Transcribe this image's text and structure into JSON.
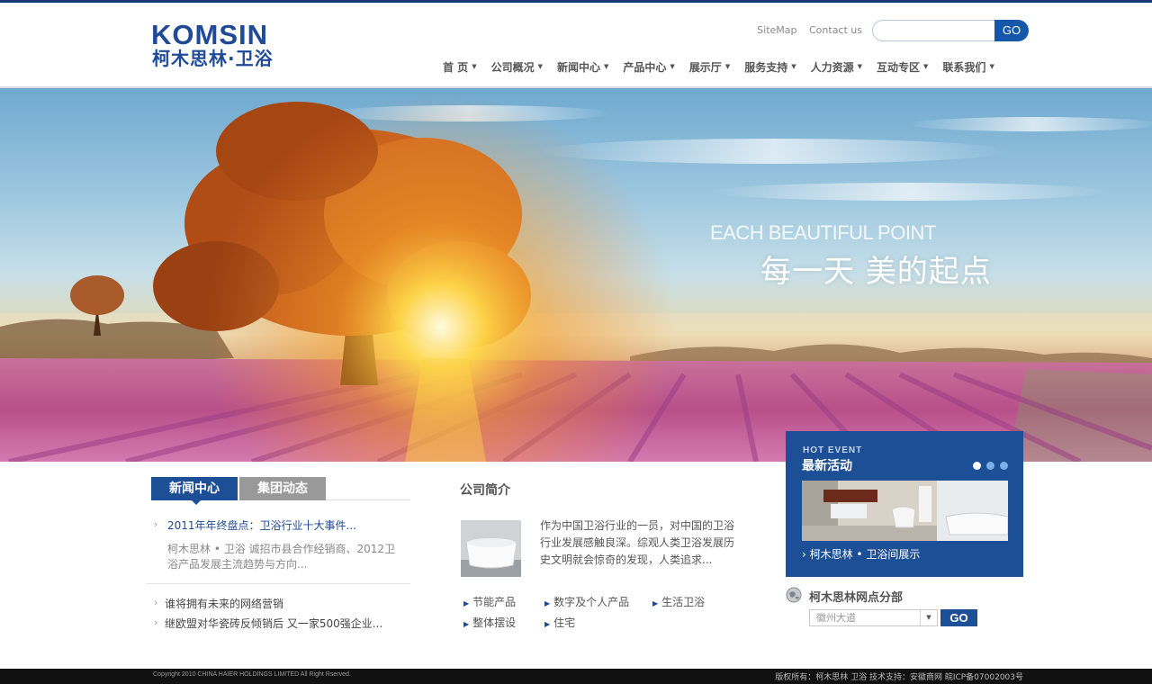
{
  "header": {
    "logo_en": "KOMSIN",
    "logo_cn": "柯木思林·卫浴",
    "top_links": [
      "SiteMap",
      "Contact us"
    ],
    "search": {
      "placeholder": "",
      "button": "GO"
    },
    "nav": [
      "首 页",
      "公司概况",
      "新闻中心",
      "产品中心",
      "展示厅",
      "服务支持",
      "人力资源",
      "互动专区",
      "联系我们"
    ]
  },
  "banner": {
    "title_en": "EACH BEAUTIFUL POINT",
    "title_cn": "每一天 美的起点"
  },
  "news": {
    "tabs": [
      "新闻中心",
      "集团动态"
    ],
    "active_tab": "新闻中心",
    "featured_title": "2011年年终盘点：卫浴行业十大事件...",
    "featured_desc": "柯木思林 • 卫浴 诚招市县合作经销商、2012卫浴产品发展主流趋势与方向...",
    "items": [
      "谁将拥有未来的网络营销",
      "继欧盟对华瓷砖反倾销后 又一家500强企业..."
    ]
  },
  "about": {
    "title": "公司简介",
    "text": "作为中国卫浴行业的一员，对中国的卫浴行业发展感触良深。综观人类卫浴发展历史文明就会惊奇的发现，人类追求...",
    "links": [
      "节能产品",
      "数字及个人产品",
      "生活卫浴",
      "整体摆设",
      "住宅"
    ]
  },
  "event": {
    "label_en": "HOT EVENT",
    "label_cn": "最新活动",
    "slide_count": 3,
    "active_slide": 1,
    "caption": "柯木思林 • 卫浴间展示"
  },
  "outlet": {
    "title": "柯木思林网点分部",
    "selected": "徽州大道",
    "button": "GO"
  },
  "footer": {
    "copyright": "Copyright 2010 CHINA HAIER HOLDINGS LIMITED All Right Rserved.",
    "info": "版权所有：柯木思林 卫浴 技术支持：安徽商网 皖ICP备07002003号"
  },
  "colors": {
    "brand_blue": "#1d4f97",
    "tab_inactive": "#999999",
    "footer_bg": "#111111"
  }
}
